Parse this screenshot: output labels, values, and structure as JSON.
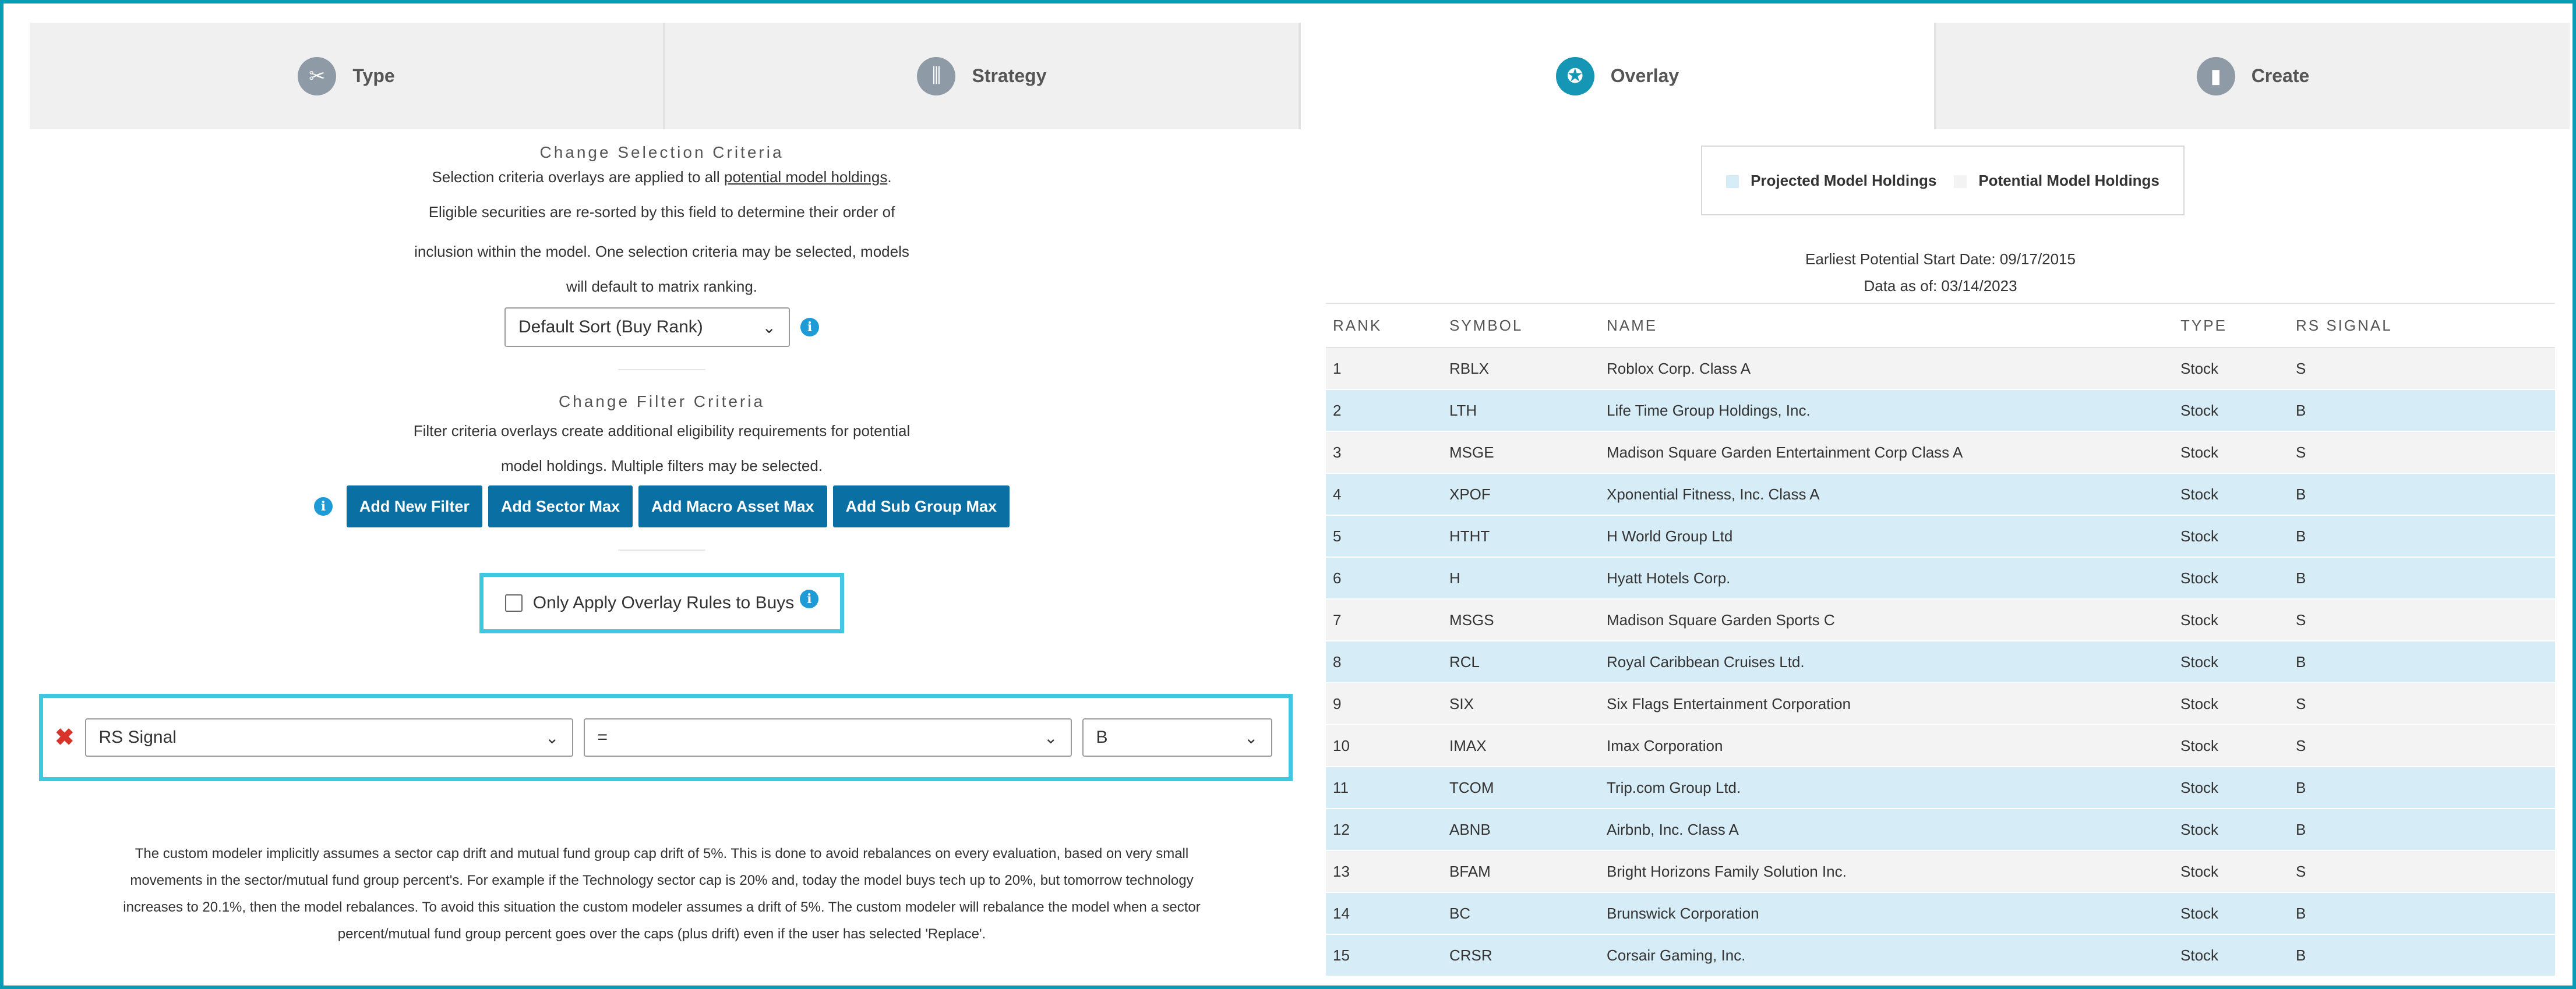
{
  "tabs": [
    {
      "label": "Type",
      "icon": "wrench-screwdriver-icon"
    },
    {
      "label": "Strategy",
      "icon": "sliders-icon"
    },
    {
      "label": "Overlay",
      "icon": "overlay-icon"
    },
    {
      "label": "Create",
      "icon": "bar-chart-icon"
    }
  ],
  "selection": {
    "title": "Change Selection Criteria",
    "line1_prefix": "Selection criteria overlays are applied to all ",
    "line1_link": "potential model holdings",
    "line1_suffix": ".",
    "line2": "Eligible securities are re-sorted by this field to determine their order of",
    "line3": "inclusion within the model. One selection criteria may be selected, models",
    "line4": "will default to matrix ranking.",
    "sort_value": "Default Sort (Buy Rank)"
  },
  "filter": {
    "title": "Change Filter Criteria",
    "line1": "Filter criteria overlays create additional eligibility requirements for potential",
    "line2": "model holdings. Multiple filters may be selected.",
    "buttons": [
      "Add New Filter",
      "Add Sector Max",
      "Add Macro Asset Max",
      "Add Sub Group Max"
    ]
  },
  "overlay_checkbox_label": "Only Apply Overlay Rules to Buys",
  "rule": {
    "field": "RS Signal",
    "operator": "=",
    "value": "B"
  },
  "note": {
    "line1": "The custom modeler implicitly assumes a sector cap drift and mutual fund group cap drift of 5%. This is done to avoid rebalances on every evaluation, based on very small",
    "line2": "movements in the sector/mutual fund group percent's. For example if the Technology sector cap is 20% and, today the model buys tech up to 20%, but tomorrow technology",
    "line3": "increases to 20.1%, then the model rebalances. To avoid this situation the custom modeler assumes a drift of 5%. The custom modeler will rebalance the model when a sector",
    "line4": "percent/mutual fund group percent goes over the caps (plus drift) even if the user has selected 'Replace'."
  },
  "legend": {
    "projected": "Projected Model Holdings",
    "potential": "Potential Model Holdings"
  },
  "dates": {
    "start": "Earliest Potential Start Date: 09/17/2015",
    "asof": "Data as of: 03/14/2023"
  },
  "table": {
    "headers": [
      "RANK",
      "SYMBOL",
      "NAME",
      "TYPE",
      "RS SIGNAL"
    ],
    "rows": [
      {
        "rank": "1",
        "symbol": "RBLX",
        "name": "Roblox Corp. Class A",
        "type": "Stock",
        "signal": "S"
      },
      {
        "rank": "2",
        "symbol": "LTH",
        "name": "Life Time Group Holdings, Inc.",
        "type": "Stock",
        "signal": "B"
      },
      {
        "rank": "3",
        "symbol": "MSGE",
        "name": "Madison Square Garden Entertainment Corp Class A",
        "type": "Stock",
        "signal": "S"
      },
      {
        "rank": "4",
        "symbol": "XPOF",
        "name": "Xponential Fitness, Inc. Class A",
        "type": "Stock",
        "signal": "B"
      },
      {
        "rank": "5",
        "symbol": "HTHT",
        "name": "H World Group Ltd",
        "type": "Stock",
        "signal": "B"
      },
      {
        "rank": "6",
        "symbol": "H",
        "name": "Hyatt Hotels Corp.",
        "type": "Stock",
        "signal": "B"
      },
      {
        "rank": "7",
        "symbol": "MSGS",
        "name": "Madison Square Garden Sports C",
        "type": "Stock",
        "signal": "S"
      },
      {
        "rank": "8",
        "symbol": "RCL",
        "name": "Royal Caribbean Cruises Ltd.",
        "type": "Stock",
        "signal": "B"
      },
      {
        "rank": "9",
        "symbol": "SIX",
        "name": "Six Flags Entertainment Corporation",
        "type": "Stock",
        "signal": "S"
      },
      {
        "rank": "10",
        "symbol": "IMAX",
        "name": "Imax Corporation",
        "type": "Stock",
        "signal": "S"
      },
      {
        "rank": "11",
        "symbol": "TCOM",
        "name": "Trip.com Group Ltd.",
        "type": "Stock",
        "signal": "B"
      },
      {
        "rank": "12",
        "symbol": "ABNB",
        "name": "Airbnb, Inc. Class A",
        "type": "Stock",
        "signal": "B"
      },
      {
        "rank": "13",
        "symbol": "BFAM",
        "name": "Bright Horizons Family Solution Inc.",
        "type": "Stock",
        "signal": "S"
      },
      {
        "rank": "14",
        "symbol": "BC",
        "name": "Brunswick Corporation",
        "type": "Stock",
        "signal": "B"
      },
      {
        "rank": "15",
        "symbol": "CRSR",
        "name": "Corsair Gaming, Inc.",
        "type": "Stock",
        "signal": "B"
      }
    ]
  }
}
